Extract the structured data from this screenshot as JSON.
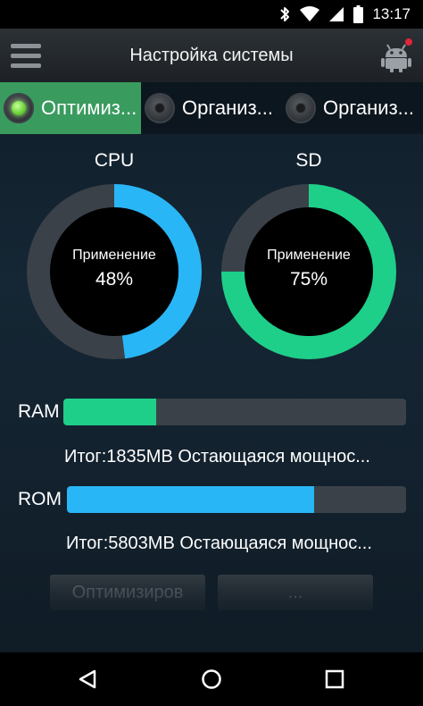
{
  "status_bar": {
    "time": "13:17",
    "icons": [
      "bluetooth-icon",
      "wifi-icon",
      "signal-icon",
      "battery-icon"
    ]
  },
  "app_bar": {
    "title": "Настройка системы",
    "menu_icon": "hamburger-menu-icon",
    "action_icon": "android-robot-icon"
  },
  "tabs": [
    {
      "label": "Оптимиз...",
      "active": true
    },
    {
      "label": "Организ...",
      "active": false
    },
    {
      "label": "Организ...",
      "active": false
    }
  ],
  "gauges": {
    "cpu": {
      "title": "CPU",
      "caption": "Применение",
      "value_text": "48%",
      "percent": 48,
      "color": "#29b6f6"
    },
    "sd": {
      "title": "SD",
      "caption": "Применение",
      "value_text": "75%",
      "percent": 75,
      "color": "#1ecf8a"
    }
  },
  "bars": {
    "ram": {
      "label": "RAM",
      "info": "Итог:1835MB Остающаяся мощнос...",
      "fill_percent": 27,
      "color": "#1ecf8a"
    },
    "rom": {
      "label": "ROM",
      "info": "Итог:5803MB Остающаяся мощнос...",
      "fill_percent": 73,
      "color": "#29b6f6"
    }
  },
  "buttons": {
    "optimize": "Оптимизиров",
    "more": "..."
  },
  "colors": {
    "track": "#3b4148",
    "active_tab": "#3a9b5f"
  },
  "nav": {
    "back_icon": "back-triangle-icon",
    "home_icon": "home-circle-icon",
    "recents_icon": "recents-square-icon"
  }
}
